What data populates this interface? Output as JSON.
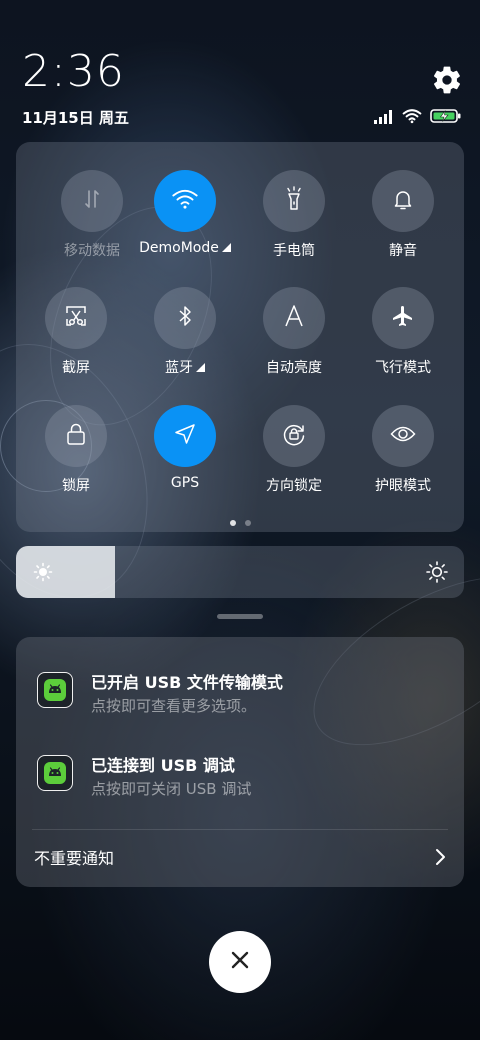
{
  "status_bar": {
    "time": "2:36",
    "date": "11月15日 周五",
    "icons": [
      "signal-icon",
      "wifi-icon",
      "battery-charging-icon"
    ]
  },
  "quick_settings": {
    "tiles": [
      {
        "label": "移动数据",
        "icon": "mobile-data-icon",
        "active": false,
        "disabled": true
      },
      {
        "label": "DemoMode",
        "icon": "wifi-icon",
        "active": true,
        "has_menu": true
      },
      {
        "label": "手电筒",
        "icon": "flashlight-icon",
        "active": false
      },
      {
        "label": "静音",
        "icon": "bell-icon",
        "active": false
      },
      {
        "label": "截屏",
        "icon": "screenshot-icon",
        "active": false
      },
      {
        "label": "蓝牙",
        "icon": "bluetooth-icon",
        "active": false,
        "has_menu": true
      },
      {
        "label": "自动亮度",
        "icon": "auto-brightness-icon",
        "active": false
      },
      {
        "label": "飞行模式",
        "icon": "airplane-icon",
        "active": false
      },
      {
        "label": "锁屏",
        "icon": "lock-icon",
        "active": false
      },
      {
        "label": "GPS",
        "icon": "location-arrow-icon",
        "active": true
      },
      {
        "label": "方向锁定",
        "icon": "rotation-lock-icon",
        "active": false
      },
      {
        "label": "护眼模式",
        "icon": "eye-icon",
        "active": false
      }
    ],
    "page_count": 2,
    "current_page": 1
  },
  "brightness": {
    "level_fraction": 0.22
  },
  "notifications": [
    {
      "title": "已开启 USB 文件传输模式",
      "subtitle": "点按即可查看更多选项。",
      "icon": "android-app-icon"
    },
    {
      "title": "已连接到 USB 调试",
      "subtitle": "点按即可关闭 USB 调试",
      "icon": "android-app-icon"
    }
  ],
  "unimportant_label": "不重要通知",
  "colors": {
    "accent": "#0a92f5"
  }
}
